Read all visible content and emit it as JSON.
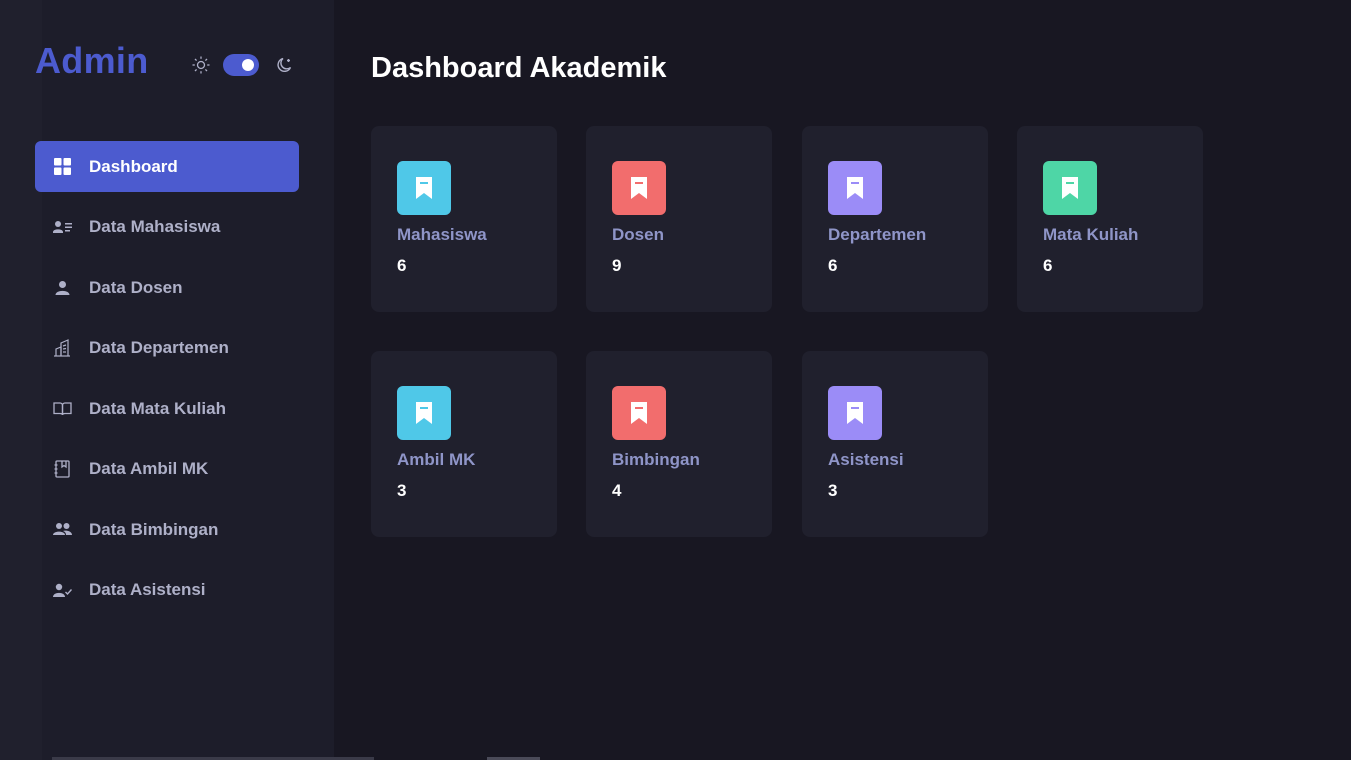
{
  "sidebar": {
    "brand": "Admin",
    "items": [
      {
        "label": "Dashboard",
        "icon": "grid-icon",
        "active": true
      },
      {
        "label": "Data Mahasiswa",
        "icon": "id-card-icon"
      },
      {
        "label": "Data Dosen",
        "icon": "user-icon"
      },
      {
        "label": "Data Departemen",
        "icon": "building-icon"
      },
      {
        "label": "Data Mata Kuliah",
        "icon": "book-icon"
      },
      {
        "label": "Data Ambil MK",
        "icon": "notebook-icon"
      },
      {
        "label": "Data Bimbingan",
        "icon": "users-icon"
      },
      {
        "label": "Data Asistensi",
        "icon": "user-check-icon"
      }
    ]
  },
  "theme": {
    "mode": "dark",
    "accent": "#4c5bcf"
  },
  "main": {
    "title": "Dashboard Akademik",
    "cards": [
      {
        "label": "Mahasiswa",
        "value": "6",
        "color": "#4fc8e8",
        "icon": "bookmark-icon"
      },
      {
        "label": "Dosen",
        "value": "9",
        "color": "#f26d6d",
        "icon": "bookmark-icon"
      },
      {
        "label": "Departemen",
        "value": "6",
        "color": "#9b8cf7",
        "icon": "bookmark-icon"
      },
      {
        "label": "Mata Kuliah",
        "value": "6",
        "color": "#4ed6a6",
        "icon": "bookmark-icon"
      },
      {
        "label": "Ambil MK",
        "value": "3",
        "color": "#4fc8e8",
        "icon": "bookmark-icon"
      },
      {
        "label": "Bimbingan",
        "value": "4",
        "color": "#f26d6d",
        "icon": "bookmark-icon"
      },
      {
        "label": "Asistensi",
        "value": "3",
        "color": "#9b8cf7",
        "icon": "bookmark-icon"
      }
    ]
  }
}
